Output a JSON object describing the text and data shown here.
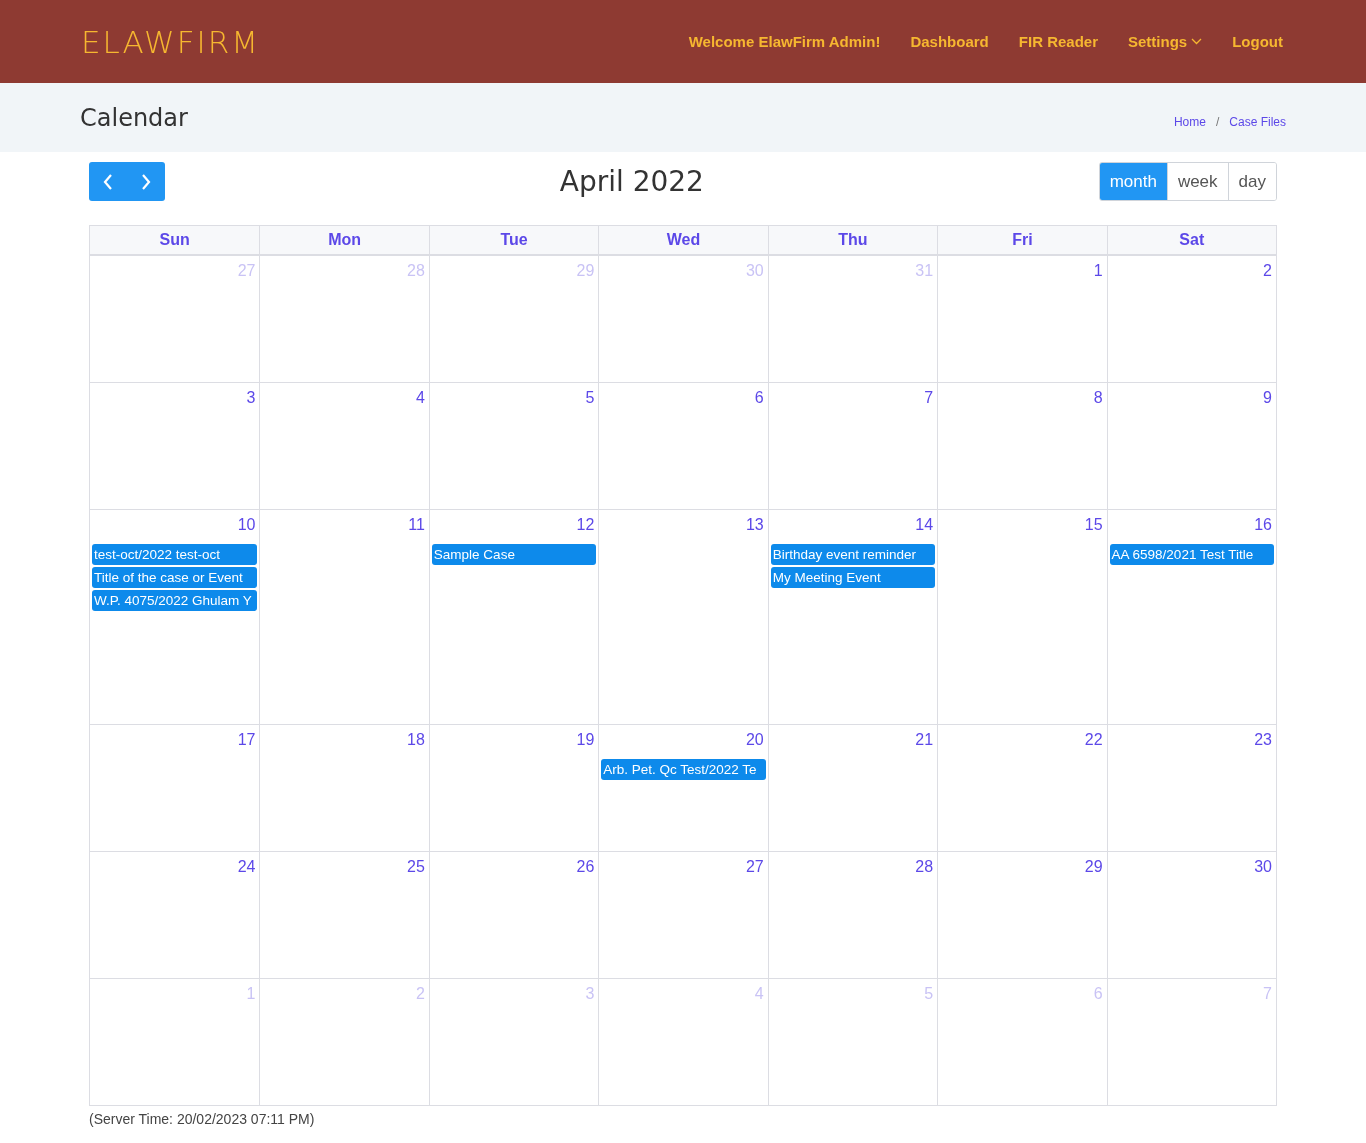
{
  "brand": "ELAWFIRM",
  "nav": [
    {
      "label": "Welcome ElawFirm Admin!",
      "dropdown": false
    },
    {
      "label": "Dashboard",
      "dropdown": false
    },
    {
      "label": "FIR Reader",
      "dropdown": false
    },
    {
      "label": "Settings",
      "dropdown": true
    },
    {
      "label": "Logout",
      "dropdown": false
    }
  ],
  "page_title": "Calendar",
  "breadcrumb": {
    "items": [
      "Home",
      "Case Files"
    ],
    "separator": "/"
  },
  "calendar": {
    "title": "April 2022",
    "views": [
      {
        "label": "month",
        "selected": true
      },
      {
        "label": "week",
        "selected": false
      },
      {
        "label": "day",
        "selected": false
      }
    ],
    "weekdays": [
      "Sun",
      "Mon",
      "Tue",
      "Wed",
      "Thu",
      "Fri",
      "Sat"
    ],
    "weeks": [
      [
        {
          "day": "27",
          "other_month": true
        },
        {
          "day": "28",
          "other_month": true
        },
        {
          "day": "29",
          "other_month": true
        },
        {
          "day": "30",
          "other_month": true
        },
        {
          "day": "31",
          "other_month": true
        },
        {
          "day": "1",
          "other_month": false
        },
        {
          "day": "2",
          "other_month": false
        }
      ],
      [
        {
          "day": "3",
          "other_month": false
        },
        {
          "day": "4",
          "other_month": false
        },
        {
          "day": "5",
          "other_month": false
        },
        {
          "day": "6",
          "other_month": false
        },
        {
          "day": "7",
          "other_month": false
        },
        {
          "day": "8",
          "other_month": false
        },
        {
          "day": "9",
          "other_month": false
        }
      ],
      [
        {
          "day": "10",
          "other_month": false,
          "events": [
            "test-oct/2022 test-oct",
            "Title of the case or Event",
            "W.P. 4075/2022 Ghulam Y"
          ]
        },
        {
          "day": "11",
          "other_month": false
        },
        {
          "day": "12",
          "other_month": false,
          "events": [
            "Sample Case"
          ]
        },
        {
          "day": "13",
          "other_month": false
        },
        {
          "day": "14",
          "other_month": false,
          "events": [
            "Birthday event reminder",
            "My Meeting Event"
          ]
        },
        {
          "day": "15",
          "other_month": false
        },
        {
          "day": "16",
          "other_month": false,
          "events": [
            "AA 6598/2021 Test Title"
          ]
        }
      ],
      [
        {
          "day": "17",
          "other_month": false
        },
        {
          "day": "18",
          "other_month": false
        },
        {
          "day": "19",
          "other_month": false
        },
        {
          "day": "20",
          "other_month": false,
          "events": [
            "Arb. Pet. Qc Test/2022 Te"
          ]
        },
        {
          "day": "21",
          "other_month": false
        },
        {
          "day": "22",
          "other_month": false
        },
        {
          "day": "23",
          "other_month": false
        }
      ],
      [
        {
          "day": "24",
          "other_month": false
        },
        {
          "day": "25",
          "other_month": false
        },
        {
          "day": "26",
          "other_month": false
        },
        {
          "day": "27",
          "other_month": false
        },
        {
          "day": "28",
          "other_month": false
        },
        {
          "day": "29",
          "other_month": false
        },
        {
          "day": "30",
          "other_month": false
        }
      ],
      [
        {
          "day": "1",
          "other_month": true
        },
        {
          "day": "2",
          "other_month": true
        },
        {
          "day": "3",
          "other_month": true
        },
        {
          "day": "4",
          "other_month": true
        },
        {
          "day": "5",
          "other_month": true
        },
        {
          "day": "6",
          "other_month": true
        },
        {
          "day": "7",
          "other_month": true
        }
      ]
    ]
  },
  "server_time": "(Server Time: 20/02/2023 07:11 PM)"
}
